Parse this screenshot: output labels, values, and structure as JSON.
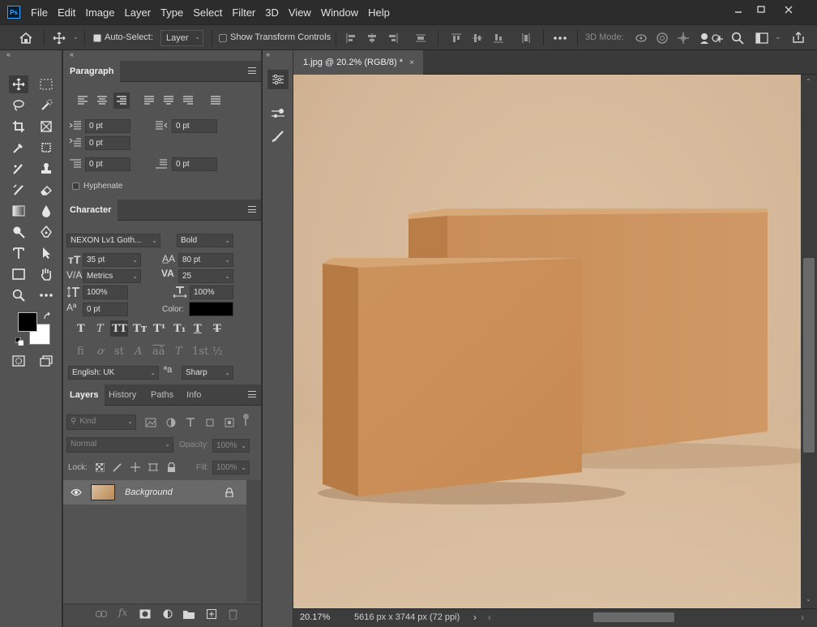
{
  "app": {
    "logo_text": "Ps"
  },
  "menu": [
    "File",
    "Edit",
    "Image",
    "Layer",
    "Type",
    "Select",
    "Filter",
    "3D",
    "View",
    "Window",
    "Help"
  ],
  "options": {
    "auto_select_label": "Auto-Select:",
    "auto_select_value": "Layer",
    "show_transform_label": "Show Transform Controls",
    "mode_3d_label": "3D Mode:"
  },
  "paragraph": {
    "tab": "Paragraph",
    "indent_left": "0 pt",
    "indent_right": "0 pt",
    "indent_first": "0 pt",
    "space_before": "0 pt",
    "space_after": "0 pt",
    "hyphenate_label": "Hyphenate"
  },
  "character": {
    "tab": "Character",
    "font_family": "NEXON Lv1 Goth...",
    "font_style": "Bold",
    "font_size": "35 pt",
    "leading": "80 pt",
    "kerning": "Metrics",
    "tracking": "25",
    "vertical_scale": "100%",
    "horizontal_scale": "100%",
    "baseline_shift": "0 pt",
    "color_label": "Color:",
    "color_value": "#000000",
    "language": "English: UK",
    "antialias_symbol": "ªa",
    "antialias": "Sharp",
    "type_styles": [
      "T",
      "T",
      "TT",
      "Tт",
      "T¹",
      "T₁",
      "T",
      "T"
    ],
    "opentype": [
      "fi",
      "ơ",
      "st",
      "A",
      "aā",
      "T",
      "1st",
      "½"
    ]
  },
  "layers_panel": {
    "tabs": [
      "Layers",
      "History",
      "Paths",
      "Info"
    ],
    "filter_label": "Kind",
    "blend_mode": "Normal",
    "opacity_label": "Opacity:",
    "opacity_value": "100%",
    "lock_label": "Lock:",
    "fill_label": "Fill:",
    "fill_value": "100%",
    "layers": [
      {
        "name": "Background",
        "visible": true,
        "locked": true
      }
    ]
  },
  "document": {
    "tab_title": "1.jpg @ 20.2% (RGB/8) *",
    "close_symbol": "×",
    "zoom": "20.17%",
    "info": "5616 px x 3744 px (72 ppi)"
  },
  "colors": {
    "foreground": "#000000",
    "background": "#ffffff",
    "accent": "#31a8ff"
  }
}
